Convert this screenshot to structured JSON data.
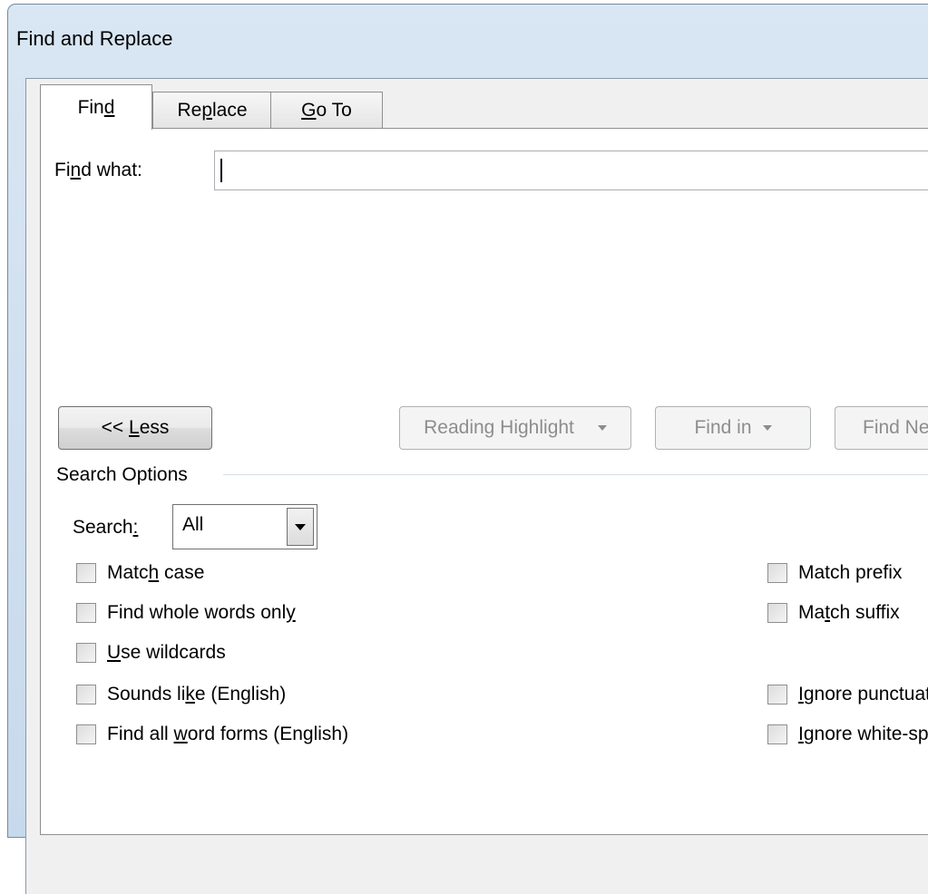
{
  "window": {
    "title": "Find and Replace"
  },
  "tabs": [
    {
      "pre": "Fin",
      "u": "d",
      "post": "",
      "active": true
    },
    {
      "pre": "Re",
      "u": "p",
      "post": "lace",
      "active": false
    },
    {
      "pre": "",
      "u": "G",
      "post": "o To",
      "active": false
    }
  ],
  "find": {
    "label_pre": "Fi",
    "label_u": "n",
    "label_post": "d what:",
    "value": ""
  },
  "buttons": {
    "less_pre": "<< ",
    "less_u": "L",
    "less_post": "ess",
    "reading_highlight": "Reading Highlight",
    "find_in": "Find in",
    "find_next": "Find Next"
  },
  "search_options": {
    "title": "Search Options",
    "search_label_pre": "Search",
    "search_label_u": ":",
    "search_value": "All"
  },
  "checkboxes_left": [
    {
      "pre": "Matc",
      "u": "h",
      "post": " case",
      "checked": false
    },
    {
      "pre": "Find whole words onl",
      "u": "y",
      "post": "",
      "checked": false
    },
    {
      "pre": "",
      "u": "U",
      "post": "se wildcards",
      "checked": false
    },
    {
      "pre": "Sounds li",
      "u": "k",
      "post": "e (English)",
      "checked": false
    },
    {
      "pre": "Find all ",
      "u": "w",
      "post": "ord forms (English)",
      "checked": false
    }
  ],
  "checkboxes_right": [
    {
      "pre": "Match prefix",
      "u": "",
      "post": "",
      "checked": false
    },
    {
      "pre": "Ma",
      "u": "t",
      "post": "ch suffix",
      "checked": false
    },
    {
      "pre": "",
      "u": "I",
      "post": "gnore punctuation characters",
      "checked": false
    },
    {
      "pre": "",
      "u": "I",
      "post": "gnore white-space characters",
      "checked": false
    }
  ]
}
